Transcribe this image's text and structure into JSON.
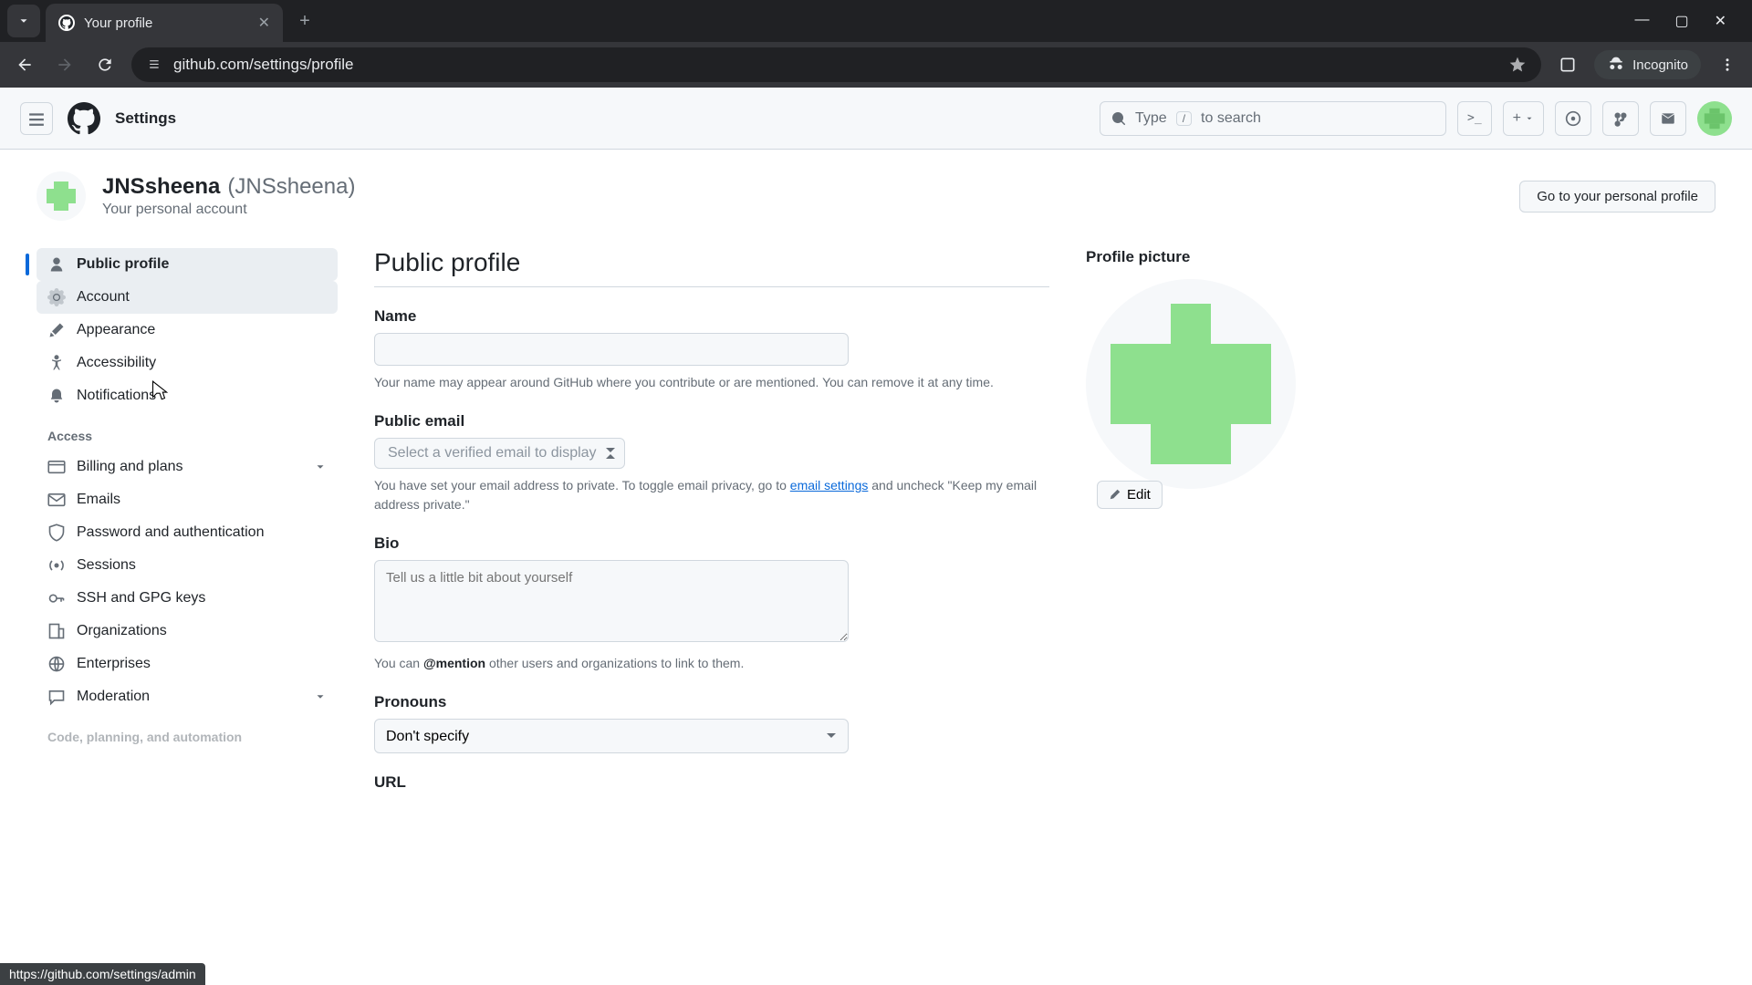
{
  "browser": {
    "tab_title": "Your profile",
    "url": "github.com/settings/profile",
    "incognito_label": "Incognito",
    "status_url": "https://github.com/settings/admin"
  },
  "header": {
    "title": "Settings",
    "search_placeholder_pre": "Type",
    "search_placeholder_post": "to search"
  },
  "user": {
    "display_name": "JNSsheena",
    "handle": "(JNSsheena)",
    "subtitle": "Your personal account",
    "goto_button": "Go to your personal profile"
  },
  "sidebar": {
    "items_main": [
      {
        "label": "Public profile",
        "icon": "person"
      },
      {
        "label": "Account",
        "icon": "gear"
      },
      {
        "label": "Appearance",
        "icon": "brush"
      },
      {
        "label": "Accessibility",
        "icon": "accessibility"
      },
      {
        "label": "Notifications",
        "icon": "bell"
      }
    ],
    "section_access": "Access",
    "items_access": [
      {
        "label": "Billing and plans",
        "icon": "credit",
        "chevron": true
      },
      {
        "label": "Emails",
        "icon": "mail"
      },
      {
        "label": "Password and authentication",
        "icon": "shield"
      },
      {
        "label": "Sessions",
        "icon": "broadcast"
      },
      {
        "label": "SSH and GPG keys",
        "icon": "key"
      },
      {
        "label": "Organizations",
        "icon": "org"
      },
      {
        "label": "Enterprises",
        "icon": "globe"
      },
      {
        "label": "Moderation",
        "icon": "comment",
        "chevron": true
      }
    ],
    "section_code": "Code, planning, and automation"
  },
  "form": {
    "heading": "Public profile",
    "name_label": "Name",
    "name_help": "Your name may appear around GitHub where you contribute or are mentioned. You can remove it at any time.",
    "email_label": "Public email",
    "email_select": "Select a verified email to display",
    "email_help_pre": "You have set your email address to private. To toggle email privacy, go to ",
    "email_help_link": "email settings",
    "email_help_post": " and uncheck \"Keep my email address private.\"",
    "bio_label": "Bio",
    "bio_placeholder": "Tell us a little bit about yourself",
    "bio_help_pre": "You can ",
    "bio_help_mention": "@mention",
    "bio_help_post": " other users and organizations to link to them.",
    "pronouns_label": "Pronouns",
    "pronouns_value": "Don't specify",
    "url_label": "URL"
  },
  "picture": {
    "label": "Profile picture",
    "edit": "Edit"
  }
}
